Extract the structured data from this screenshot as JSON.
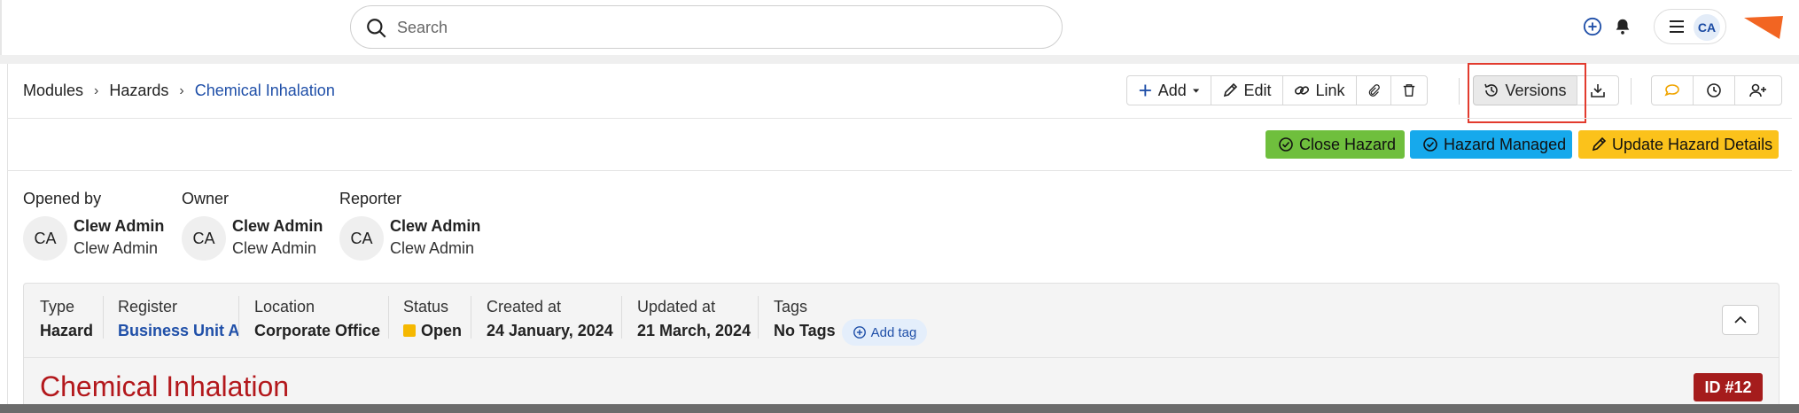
{
  "search": {
    "placeholder": "Search"
  },
  "user": {
    "initials": "CA"
  },
  "breadcrumb": {
    "items": [
      "Modules",
      "Hazards"
    ],
    "current": "Chemical Inhalation",
    "separator": "›"
  },
  "toolbar": {
    "add_label": "Add",
    "edit_label": "Edit",
    "link_label": "Link",
    "versions_label": "Versions"
  },
  "actions": {
    "close_label": "Close Hazard",
    "managed_label": "Hazard Managed",
    "update_label": "Update Hazard Details"
  },
  "people": [
    {
      "role": "Opened by",
      "initials": "CA",
      "name": "Clew Admin",
      "sub": "Clew Admin"
    },
    {
      "role": "Owner",
      "initials": "CA",
      "name": "Clew Admin",
      "sub": "Clew Admin"
    },
    {
      "role": "Reporter",
      "initials": "CA",
      "name": "Clew Admin",
      "sub": "Clew Admin"
    }
  ],
  "details": {
    "type": {
      "label": "Type",
      "value": "Hazard"
    },
    "register": {
      "label": "Register",
      "value": "Business Unit A"
    },
    "location": {
      "label": "Location",
      "value": "Corporate Office"
    },
    "status": {
      "label": "Status",
      "value": "Open",
      "color": "#f5b800"
    },
    "created": {
      "label": "Created at",
      "value": "24 January, 2024"
    },
    "updated": {
      "label": "Updated at",
      "value": "21 March, 2024"
    },
    "tags": {
      "label": "Tags",
      "value": "No Tags",
      "add_label": "Add tag"
    }
  },
  "record": {
    "title": "Chemical Inhalation",
    "id_badge": "ID #12"
  },
  "colors": {
    "accent_blue": "#1f4fa8",
    "close_green": "#6fbf3d",
    "managed_blue": "#16a9ec",
    "update_yellow": "#fbc21b",
    "title_red": "#b3181c",
    "badge_red": "#a51c1c",
    "highlight_red": "#e23b2e"
  }
}
